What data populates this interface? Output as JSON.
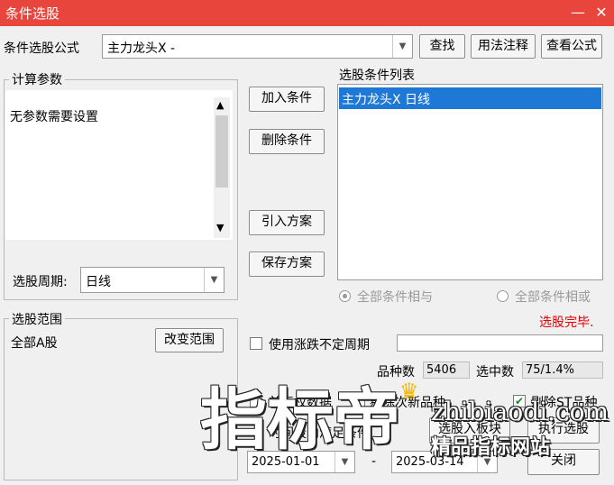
{
  "window": {
    "title": "条件选股",
    "minimize": "—",
    "close": "✕"
  },
  "formula": {
    "label": "条件选股公式",
    "value": "主力龙头X  -",
    "find": "查找",
    "usage": "用法注释",
    "view": "查看公式"
  },
  "params": {
    "legend": "计算参数",
    "text": "无参数需要设置",
    "period_label": "选股周期:",
    "period_value": "日线"
  },
  "middle": {
    "add": "加入条件",
    "delete": "删除条件",
    "import": "引入方案",
    "save": "保存方案"
  },
  "conditions": {
    "legend": "选股条件列表",
    "items": [
      "主力龙头X  日线"
    ],
    "radio_and": "全部条件相与",
    "radio_or": "全部条件相或",
    "status": "选股完毕."
  },
  "range": {
    "legend": "选股范围",
    "value": "全部A股",
    "change": "改变范围"
  },
  "options": {
    "varperiod": "使用涨跌不定周期",
    "count_label": "品种数",
    "count_value": "5406",
    "selected_label": "选中数",
    "selected_value": "75/1.4%",
    "prev_label": "前复权数据",
    "prev_checked": false,
    "sub_label": "剔除次新品种",
    "sub_checked": true,
    "st_label": "剔除ST品种",
    "st_checked": true,
    "time_label": "时间段内满足条件",
    "date_from": "2025-01-01",
    "date_sep": "-",
    "date_to": "2025-03-14"
  },
  "actions": {
    "to_block": "选股入板块",
    "execute": "执行选股",
    "close": "关闭"
  },
  "watermark": {
    "big": "指标帝",
    "url": "zhibiaodi.com",
    "small": "精品指标网站"
  },
  "colors": {
    "titlebar": "#e8453c",
    "selection": "#1e78d6",
    "status": "#e00000"
  }
}
